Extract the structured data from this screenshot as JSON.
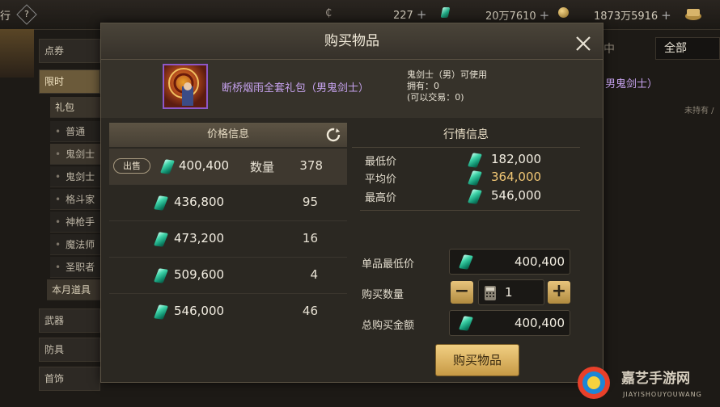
{
  "topbar": {
    "left_text": "行",
    "currency1": "227",
    "currency2": "20万7610",
    "currency3": "1873万5916",
    "plus": "+"
  },
  "sidebar": {
    "categories": [
      "点券",
      "限时",
      "武器",
      "防具",
      "首饰"
    ],
    "subheader": "礼包",
    "subitems": [
      "普通",
      "鬼剑士（",
      "鬼剑士（",
      "格斗家",
      "神枪手",
      "魔法师",
      "圣职者"
    ],
    "monthly": "本月道具"
  },
  "background": {
    "select_value": "全部",
    "tab_fragment": "中",
    "filter_fragment": "男鬼剑士）",
    "status_fragment": "未持有 /"
  },
  "modal": {
    "title": "购买物品",
    "item_name": "断桥烟雨全套礼包（男鬼剑士）",
    "usable_by": "鬼剑士（男）可使用",
    "owned": "拥有：0",
    "tradable": "(可以交易：0)",
    "price_header": "价格信息",
    "sell_tag": "出售",
    "qty_label": "数量",
    "price_rows": [
      {
        "price": "400,400",
        "qty": "378"
      },
      {
        "price": "436,800",
        "qty": "95"
      },
      {
        "price": "473,200",
        "qty": "16"
      },
      {
        "price": "509,600",
        "qty": "4"
      },
      {
        "price": "546,000",
        "qty": "46"
      }
    ],
    "market_header": "行情信息",
    "market": {
      "min_label": "最低价",
      "min_value": "182,000",
      "avg_label": "平均价",
      "avg_value": "364,000",
      "max_label": "最高价",
      "max_value": "546,000"
    },
    "form": {
      "unit_min_label": "单品最低价",
      "unit_min_value": "400,400",
      "buy_qty_label": "购买数量",
      "buy_qty_value": "1",
      "total_label": "总购买金额",
      "total_value": "400,400",
      "minus": "−",
      "plus": "+"
    },
    "buy_button": "购买物品"
  },
  "watermark": {
    "cn": "嘉艺手游网",
    "en": "JIAYISHOUYOUWANG"
  },
  "colors": {
    "accent_gold": "#e8c47c",
    "item_purple": "#c6a2ee",
    "avg_price": "#f0c674",
    "gem_green": "#3fd3a8"
  }
}
